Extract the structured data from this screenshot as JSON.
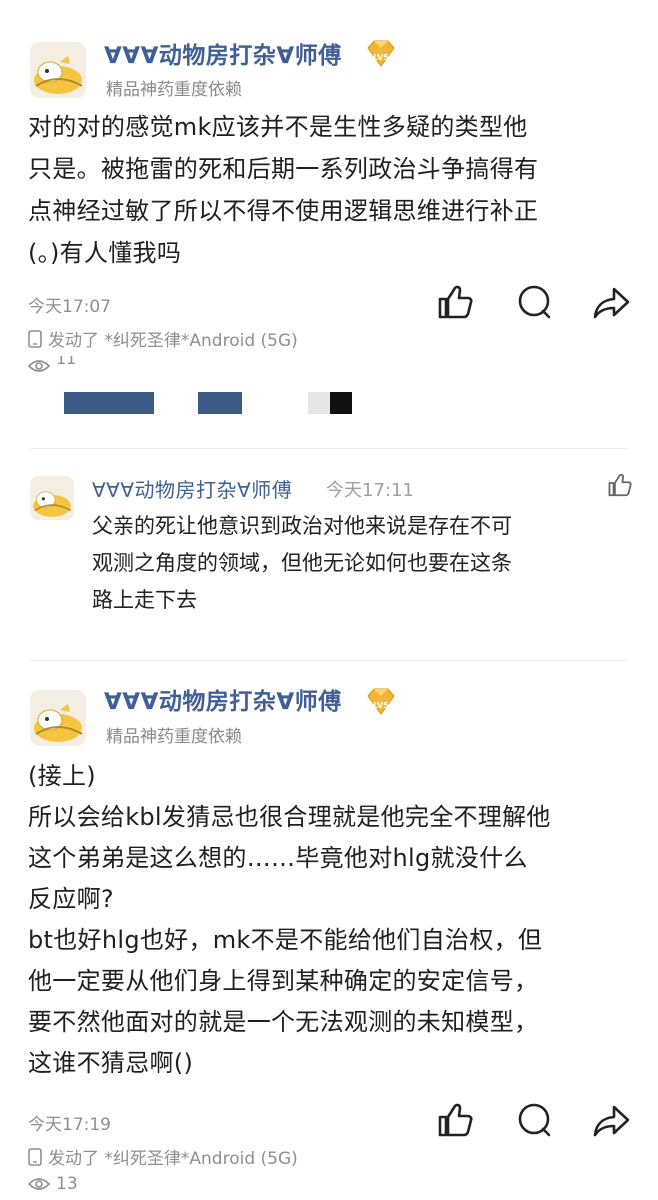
{
  "post1": {
    "username": "∀∀∀动物房打杂∀师傅",
    "badge": "LV5",
    "subtitle": "精品神药重度依赖",
    "body": "对的对的感觉mk应该并不是生性多疑的类型他\n只是。被拖雷的死和后期一系列政治斗争搞得有\n点神经过敏了所以不得不使用逻辑思维进行补正\n(。)有人懂我吗",
    "time": "今天17:07",
    "device": "发动了 *纠死圣律*Android (5G)",
    "views": "11"
  },
  "reply": {
    "username": "∀∀∀动物房打杂∀师傅",
    "time": "今天17:11",
    "body": "父亲的死让他意识到政治对他来说是存在不可\n观测之角度的领域，但他无论如何也要在这条\n路上走下去"
  },
  "post2": {
    "username": "∀∀∀动物房打杂∀师傅",
    "badge": "LV5",
    "subtitle": "精品神药重度依赖",
    "body": "(接上)\n所以会给kbl发猜忌也很合理就是他完全不理解他\n这个弟弟是这么想的……毕竟他对hlg就没什么\n反应啊?\nbt也好hlg也好，mk不是不能给他们自治权，但\n他一定要从他们身上得到某种确定的安定信号，\n要不然他面对的就是一个无法观测的未知模型，\n这谁不猜忌啊()",
    "time": "今天17:19",
    "device": "发动了 *纠死圣律*Android (5G)",
    "views": "13"
  },
  "colors": {
    "username": "#3f5f96",
    "meta": "#8f8f8f",
    "badge": "#f2b632"
  },
  "icons": [
    "like-icon",
    "comment-icon",
    "share-icon",
    "phone-icon",
    "eye-icon",
    "level-badge-icon"
  ]
}
